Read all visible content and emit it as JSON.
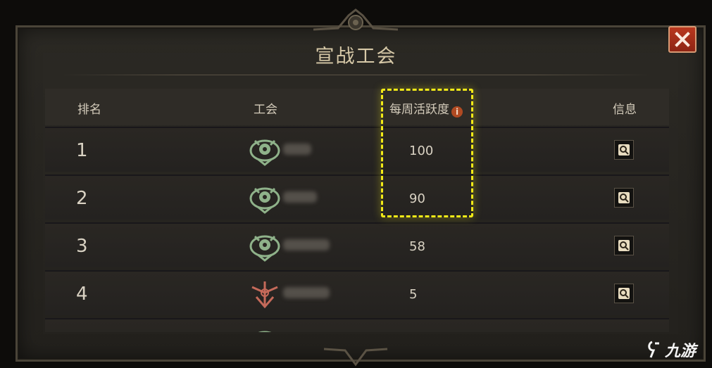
{
  "dialog": {
    "title": "宣战工会",
    "close_icon": "close-x-icon"
  },
  "table": {
    "headers": {
      "rank": "排名",
      "guild": "工会",
      "activity": "每周活跃度",
      "info": "信息"
    },
    "rows": [
      {
        "rank": "1",
        "emblem": "guild-emblem-green-icon",
        "activity": "100"
      },
      {
        "rank": "2",
        "emblem": "guild-emblem-green-icon",
        "activity": "90"
      },
      {
        "rank": "3",
        "emblem": "guild-emblem-green-icon",
        "activity": "58"
      },
      {
        "rank": "4",
        "emblem": "guild-emblem-red-icon",
        "activity": "5"
      }
    ]
  },
  "watermark": {
    "text": "九游"
  },
  "colors": {
    "accent_highlight": "#f2ea17",
    "close_button": "#a8301a",
    "emblem_green": "#8fb28a",
    "emblem_red": "#c56a5a"
  }
}
